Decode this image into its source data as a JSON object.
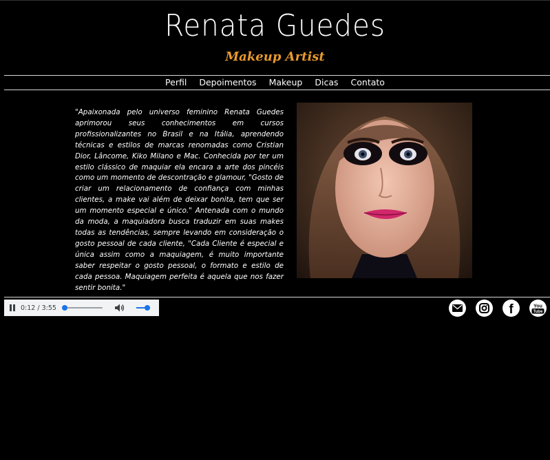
{
  "header": {
    "title": "Renata Guedes",
    "subtitle": "Makeup Artist"
  },
  "nav": {
    "items": [
      {
        "label": "Perfil"
      },
      {
        "label": "Depoimentos"
      },
      {
        "label": "Makeup"
      },
      {
        "label": "Dicas"
      },
      {
        "label": "Contato"
      }
    ]
  },
  "bio": {
    "text": "\"Apaixonada pelo universo feminino Renata Guedes aprimorou seus conhecimentos em cursos profissionalizantes no Brasil e na Itália, aprendendo técnicas e estilos de marcas renomadas como Cristian Dior, Lâncome, Kiko Milano e Mac. Conhecida por ter um estilo clássico de maquiar ela encara a arte dos pincéis como um momento de descontração e glamour, \"Gosto de criar um relacionamento de confiança com minhas clientes, a make vai além de deixar bonita, tem que ser um momento especial e único.\" Antenada com o mundo da moda, a maquiadora busca traduzir em suas makes todas as tendências, sempre levando em consideração o gosto pessoal de cada cliente, \"Cada Cliente é especial e única assim como a maquiagem, é muito importante saber respeitar o gosto pessoal, o formato e estilo de cada pessoa. Maquiagem perfeita é aquela que nos fazer sentir bonita.\""
  },
  "player": {
    "time": "0:12 / 3:55",
    "progress": 0.051,
    "volume": 0.9
  },
  "social": [
    {
      "icon": "email-icon"
    },
    {
      "icon": "instagram-icon"
    },
    {
      "icon": "facebook-icon",
      "glyph": "f"
    },
    {
      "icon": "youtube-icon",
      "glyph_top": "You",
      "glyph_bottom": "Tube"
    }
  ],
  "colors": {
    "background": "#000000",
    "accent": "#e89a2e",
    "player_accent": "#1a73e8"
  }
}
